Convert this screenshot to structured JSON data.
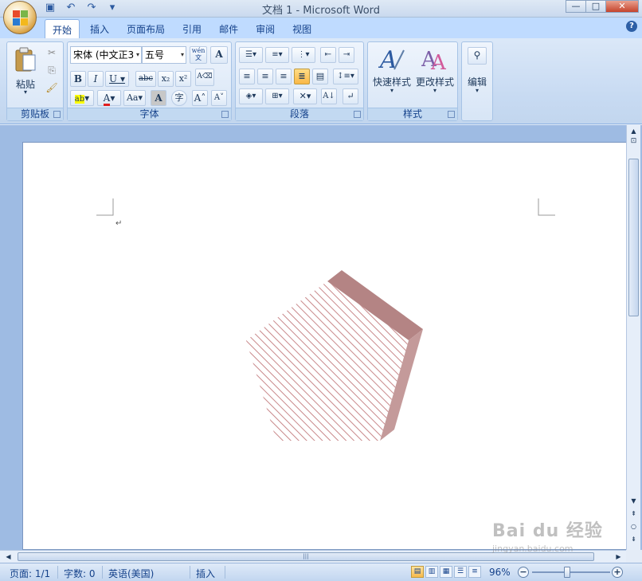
{
  "window": {
    "title": "文档 1 - Microsoft Word"
  },
  "tabs": [
    "开始",
    "插入",
    "页面布局",
    "引用",
    "邮件",
    "审阅",
    "视图"
  ],
  "clipboard": {
    "paste_label": "粘贴",
    "group_label": "剪贴板"
  },
  "font": {
    "name": "宋体 (中文正3",
    "size": "五号",
    "wen_label": "wén\n文",
    "group_label": "字体",
    "change_case": "Aa"
  },
  "paragraph": {
    "group_label": "段落"
  },
  "styles": {
    "quick_styles": "快速样式",
    "change_styles": "更改样式",
    "group_label": "样式"
  },
  "editing": {
    "label": "编辑"
  },
  "status": {
    "page": "页面: 1/1",
    "words": "字数: 0",
    "language": "英语(美国)",
    "mode": "插入",
    "zoom": "96%"
  },
  "colors": {
    "shape_fill": "#c8888a",
    "shape_side": "#b48484",
    "accent": "#15428b"
  },
  "watermark": {
    "brand": "Bai du 经验",
    "url": "jingyan.baidu.com"
  }
}
